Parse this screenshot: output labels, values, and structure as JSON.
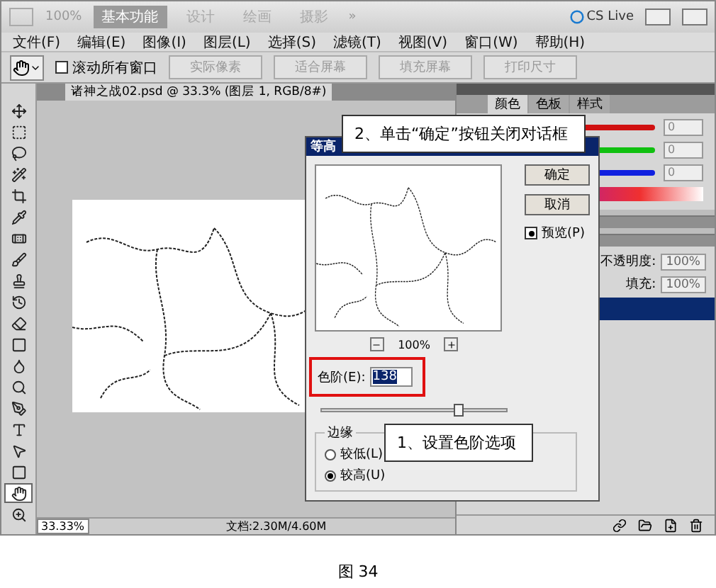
{
  "app_bar": {
    "zoom": "100%",
    "workspaces": [
      {
        "label": "基本功能",
        "selected": true
      },
      {
        "label": "设计",
        "selected": false
      },
      {
        "label": "绘画",
        "selected": false
      },
      {
        "label": "摄影",
        "selected": false
      }
    ],
    "more": "»",
    "cs_live": "CS Live"
  },
  "menu": [
    "文件(F)",
    "编辑(E)",
    "图像(I)",
    "图层(L)",
    "选择(S)",
    "滤镜(T)",
    "视图(V)",
    "窗口(W)",
    "帮助(H)"
  ],
  "options_bar": {
    "scroll_all": {
      "label": "滚动所有窗口",
      "checked": false
    },
    "buttons": [
      {
        "label": "实际像素",
        "disabled": true
      },
      {
        "label": "适合屏幕",
        "disabled": true
      },
      {
        "label": "填充屏幕",
        "disabled": true
      },
      {
        "label": "打印尺寸",
        "disabled": true
      }
    ]
  },
  "tools": [
    {
      "kind": "move",
      "selected": false
    },
    {
      "kind": "marquee",
      "selected": false
    },
    {
      "kind": "lasso",
      "selected": false
    },
    {
      "kind": "wand",
      "selected": false
    },
    {
      "kind": "crop",
      "selected": false
    },
    {
      "kind": "eyedropper",
      "selected": false
    },
    {
      "kind": "heal",
      "selected": false
    },
    {
      "kind": "brush",
      "selected": false
    },
    {
      "kind": "stamp",
      "selected": false
    },
    {
      "kind": "history",
      "selected": false
    },
    {
      "kind": "eraser",
      "selected": false
    },
    {
      "kind": "gradient",
      "selected": false
    },
    {
      "kind": "blur",
      "selected": false
    },
    {
      "kind": "dodge",
      "selected": false
    },
    {
      "kind": "pen",
      "selected": false
    },
    {
      "kind": "type",
      "selected": false
    },
    {
      "kind": "select",
      "selected": false
    },
    {
      "kind": "shape",
      "selected": false
    },
    {
      "kind": "hand",
      "selected": true
    },
    {
      "kind": "zoom",
      "selected": false
    }
  ],
  "document": {
    "tab": "诸神之战02.psd @ 33.3% (图层 1, RGB/8#)",
    "status_zoom": "33.33%",
    "status_doc": "文档:2.30M/4.60M"
  },
  "panels": {
    "tabs": [
      {
        "label": "颜色",
        "selected": true
      },
      {
        "label": "色板",
        "selected": false
      },
      {
        "label": "样式",
        "selected": false
      }
    ],
    "channels": [
      {
        "color": "#d01010",
        "value": "0"
      },
      {
        "color": "#10c010",
        "value": "0"
      },
      {
        "color": "#1020e0",
        "value": "0"
      }
    ],
    "opacity": {
      "label": "不透明度:",
      "value": "100%"
    },
    "fill": {
      "label": "填充:",
      "value": "100%"
    }
  },
  "dialog": {
    "title": "等高",
    "zoom": "100%",
    "ok": "确定",
    "cancel": "取消",
    "preview": {
      "label": "预览(P)",
      "checked": true
    },
    "level_label": "色阶(E):",
    "level_value": "138",
    "slider": {
      "level": 0.74
    },
    "edge_group": "边缘",
    "edges": [
      {
        "label": "较低(L)",
        "selected": false
      },
      {
        "label": "较高(U)",
        "selected": true
      }
    ]
  },
  "callouts": [
    "2、单击“确定”按钮关闭对话框",
    "1、设置色阶选项"
  ],
  "caption": "图 34"
}
